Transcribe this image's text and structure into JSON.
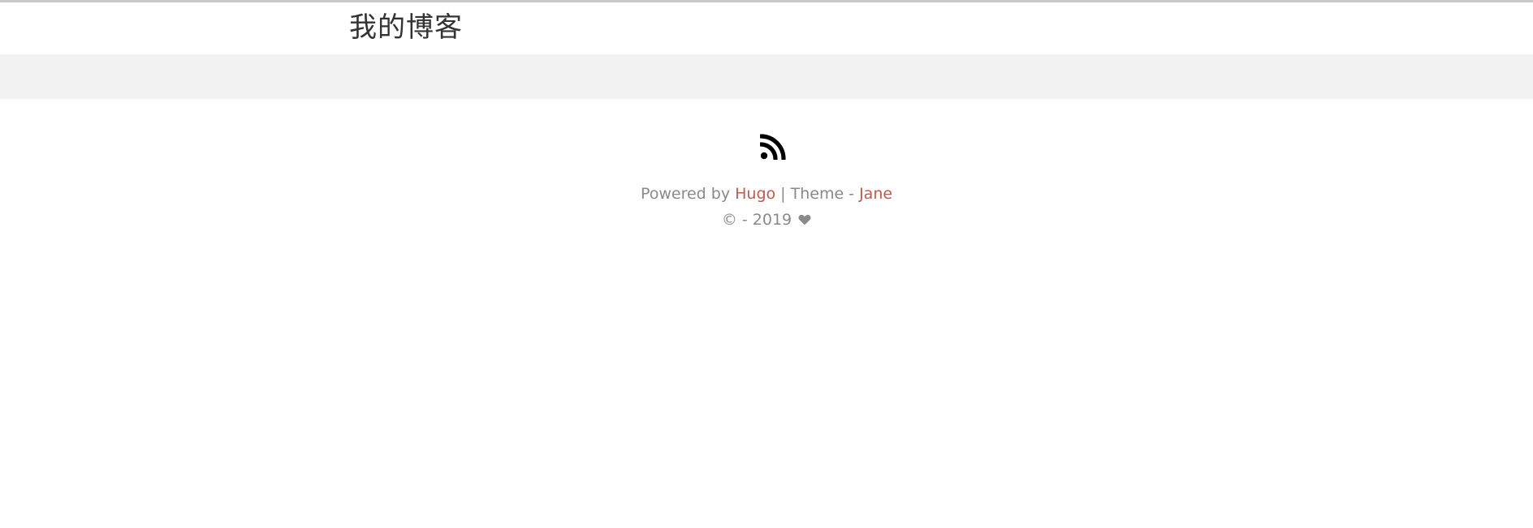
{
  "header": {
    "site_title": "我的博客"
  },
  "footer": {
    "rss_icon": "rss-icon",
    "powered_prefix": "Powered by ",
    "hugo_link": "Hugo",
    "theme_separator": " | Theme - ",
    "jane_link": "Jane",
    "copyright_text": "© - 2019",
    "heart_icon": "heart-icon"
  },
  "colors": {
    "page_background": "#fefefe",
    "header_background": "#ffffff",
    "nav_band": "#f2f2f3",
    "top_line": "#c9c9c9",
    "muted_text": "#8a8a8a",
    "accent_link": "#c05b4d",
    "title_text": "#333333"
  }
}
